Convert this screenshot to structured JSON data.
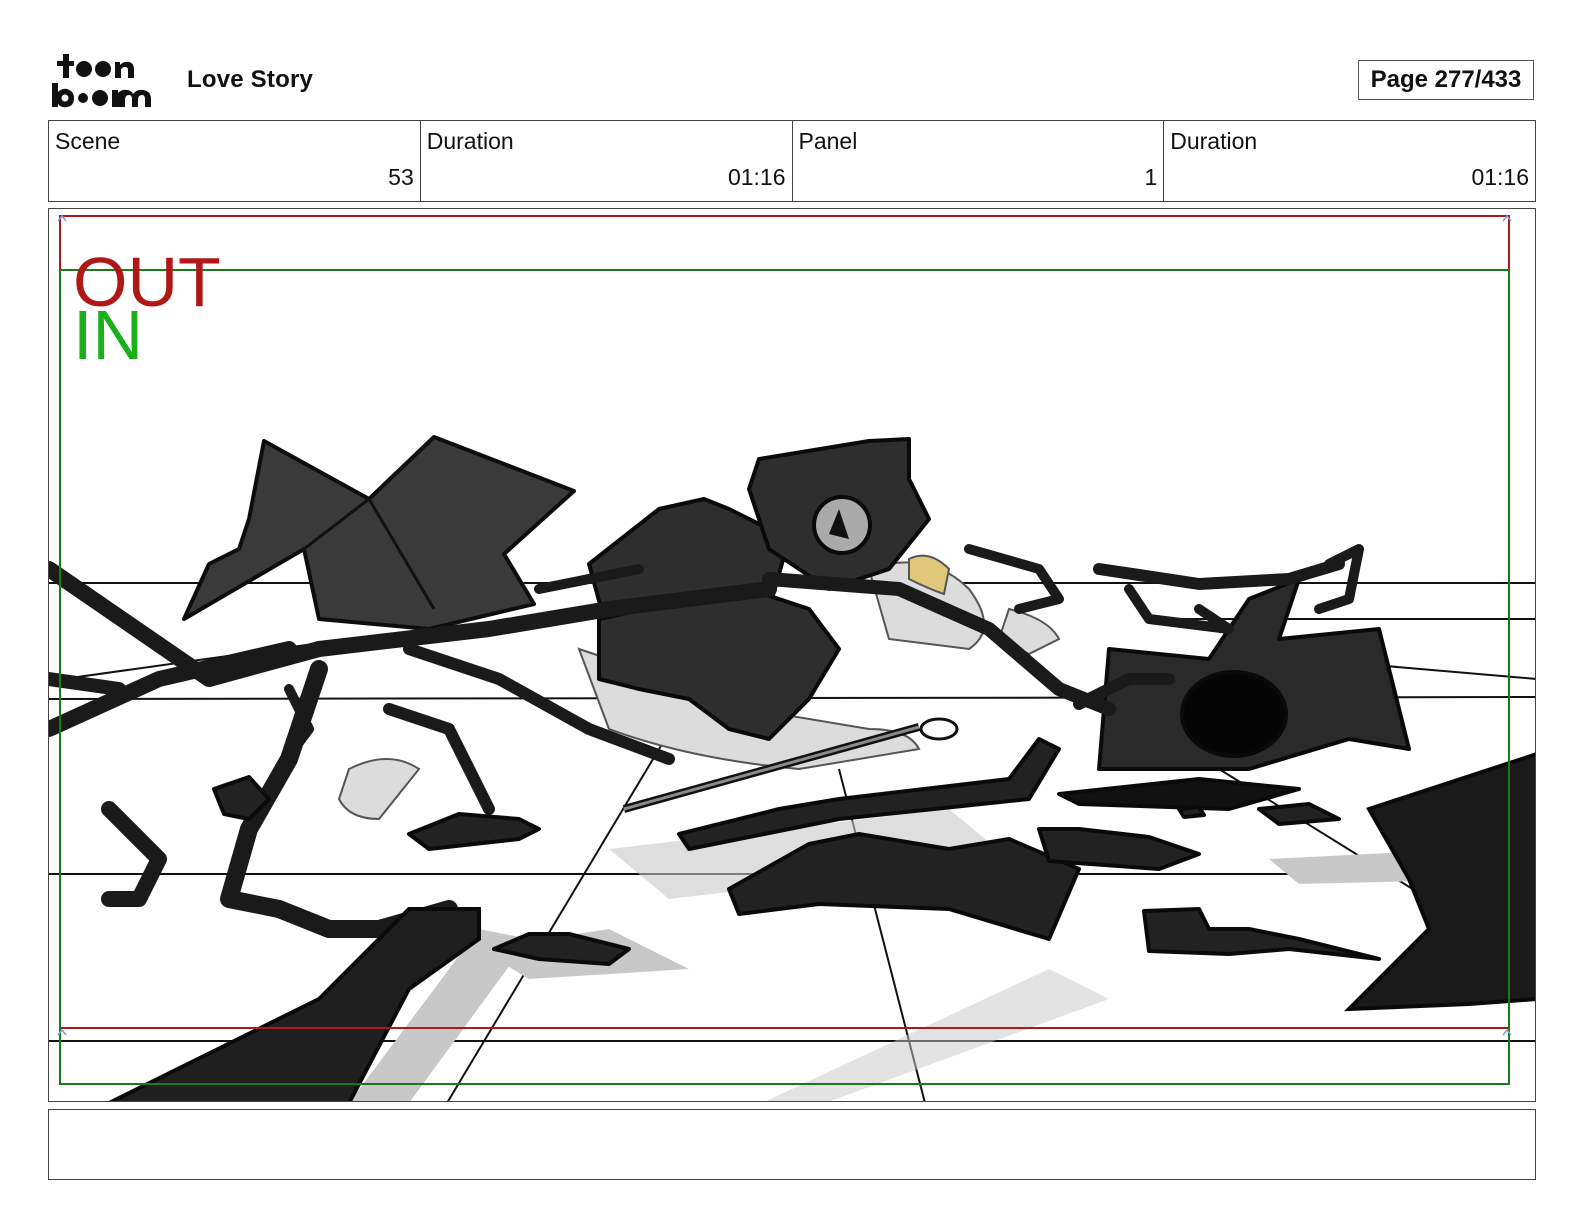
{
  "header": {
    "logo_text_top": "toon",
    "logo_text_bottom": "boom",
    "project_title": "Love Story",
    "page_label": "Page 277/433"
  },
  "info": [
    {
      "label": "Scene",
      "value": "53"
    },
    {
      "label": "Duration",
      "value": "01:16"
    },
    {
      "label": "Panel",
      "value": "1"
    },
    {
      "label": "Duration",
      "value": "01:16"
    }
  ],
  "panel": {
    "out_label": "OUT",
    "in_label": "IN",
    "colors": {
      "out_frame": "#b01818",
      "in_frame": "#1a7a1a",
      "in_text": "#1ab01a",
      "ink": "#111111"
    }
  },
  "notes": {
    "text": ""
  }
}
